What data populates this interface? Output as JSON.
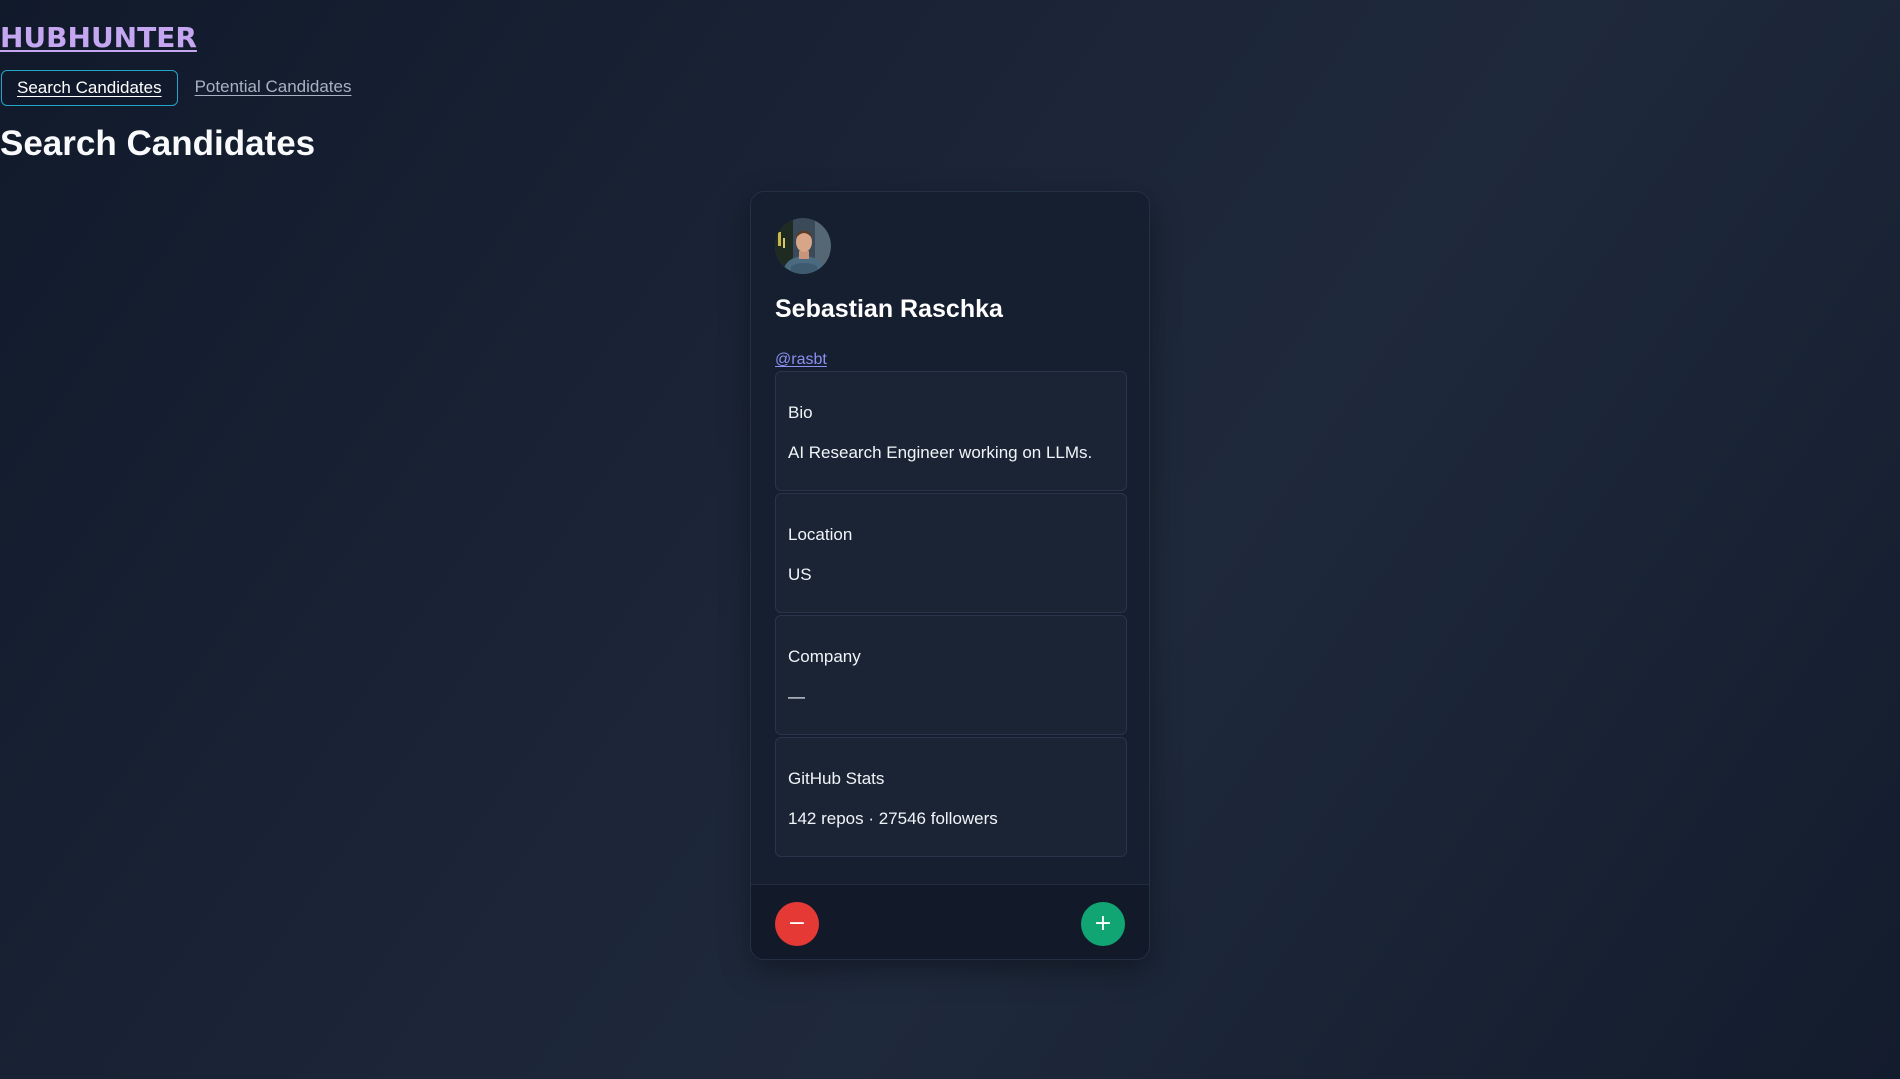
{
  "app": {
    "logo": "HUBHUNTER"
  },
  "nav": {
    "tabs": [
      {
        "label": "Search Candidates",
        "active": true
      },
      {
        "label": "Potential Candidates",
        "active": false
      }
    ]
  },
  "page": {
    "title": "Search Candidates"
  },
  "candidate": {
    "avatar_icon": "user-avatar",
    "name": "Sebastian Raschka",
    "handle": "@rasbt",
    "fields": [
      {
        "label": "Bio",
        "value": "AI Research Engineer working on LLMs."
      },
      {
        "label": "Location",
        "value": "US"
      },
      {
        "label": "Company",
        "value": "—"
      },
      {
        "label": "GitHub Stats",
        "value": "142 repos · 27546 followers"
      }
    ]
  },
  "actions": {
    "reject_symbol": "−",
    "accept_symbol": "+",
    "reject_icon": "minus-icon",
    "accept_icon": "plus-icon"
  },
  "colors": {
    "logo": "#c4a7f0",
    "active_tab_border": "#22a6c7",
    "link": "#8b8ff0",
    "reject": "#e53935",
    "accept": "#10a572"
  }
}
